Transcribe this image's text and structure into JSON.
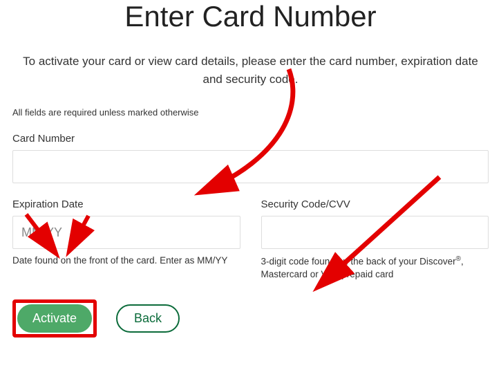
{
  "title": "Enter Card Number",
  "subtitle": "To activate your card or view card details, please enter the card number, expiration date and security code.",
  "requiredNote": "All fields are required unless marked otherwise",
  "cardNumber": {
    "label": "Card Number",
    "value": ""
  },
  "expiration": {
    "label": "Expiration Date",
    "placeholder": "MM/YY",
    "value": "",
    "helper": "Date found on the front of the card. Enter as MM/YY"
  },
  "securityCode": {
    "label": "Security Code/CVV",
    "value": "",
    "helperPrefix": "3-digit code found on the back of your Discover",
    "helperSup": "®",
    "helperSuffix": ", Mastercard or Visa prepaid card"
  },
  "buttons": {
    "activate": "Activate",
    "back": "Back"
  },
  "colors": {
    "annotationRed": "#e30000",
    "primaryGreen": "#4ea968",
    "outlineGreen": "#0b6b3a"
  }
}
